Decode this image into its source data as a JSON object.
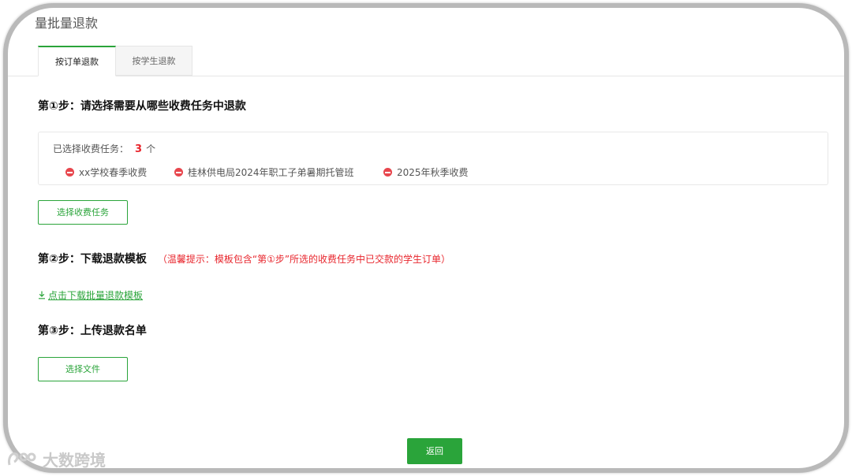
{
  "page": {
    "title": "量批量退款"
  },
  "tabs": [
    {
      "label": "按订单退款",
      "active": true
    },
    {
      "label": "按学生退款",
      "active": false
    }
  ],
  "step1": {
    "title": "第①步：请选择需要从哪些收费任务中退款",
    "selected_label": "已选择收费任务：",
    "selected_count": "3",
    "count_unit": "个",
    "tasks": [
      {
        "name": "xx学校春季收费"
      },
      {
        "name": "桂林供电局2024年职工子弟暑期托管班"
      },
      {
        "name": "2025年秋季收费"
      }
    ],
    "select_button": "选择收费任务"
  },
  "step2": {
    "title": "第②步：下载退款模板",
    "hint": "（温馨提示：模板包含“第①步”所选的收费任务中已交款的学生订单）",
    "download_link": "点击下载批量退款模板"
  },
  "step3": {
    "title": "第③步：上传退款名单",
    "file_button": "选择文件"
  },
  "footer": {
    "back_button": "返回"
  },
  "watermark": {
    "text": "大数跨境"
  },
  "colors": {
    "accent": "#2aa43a",
    "danger": "#e8262d",
    "remove_icon": "#e8464d"
  }
}
